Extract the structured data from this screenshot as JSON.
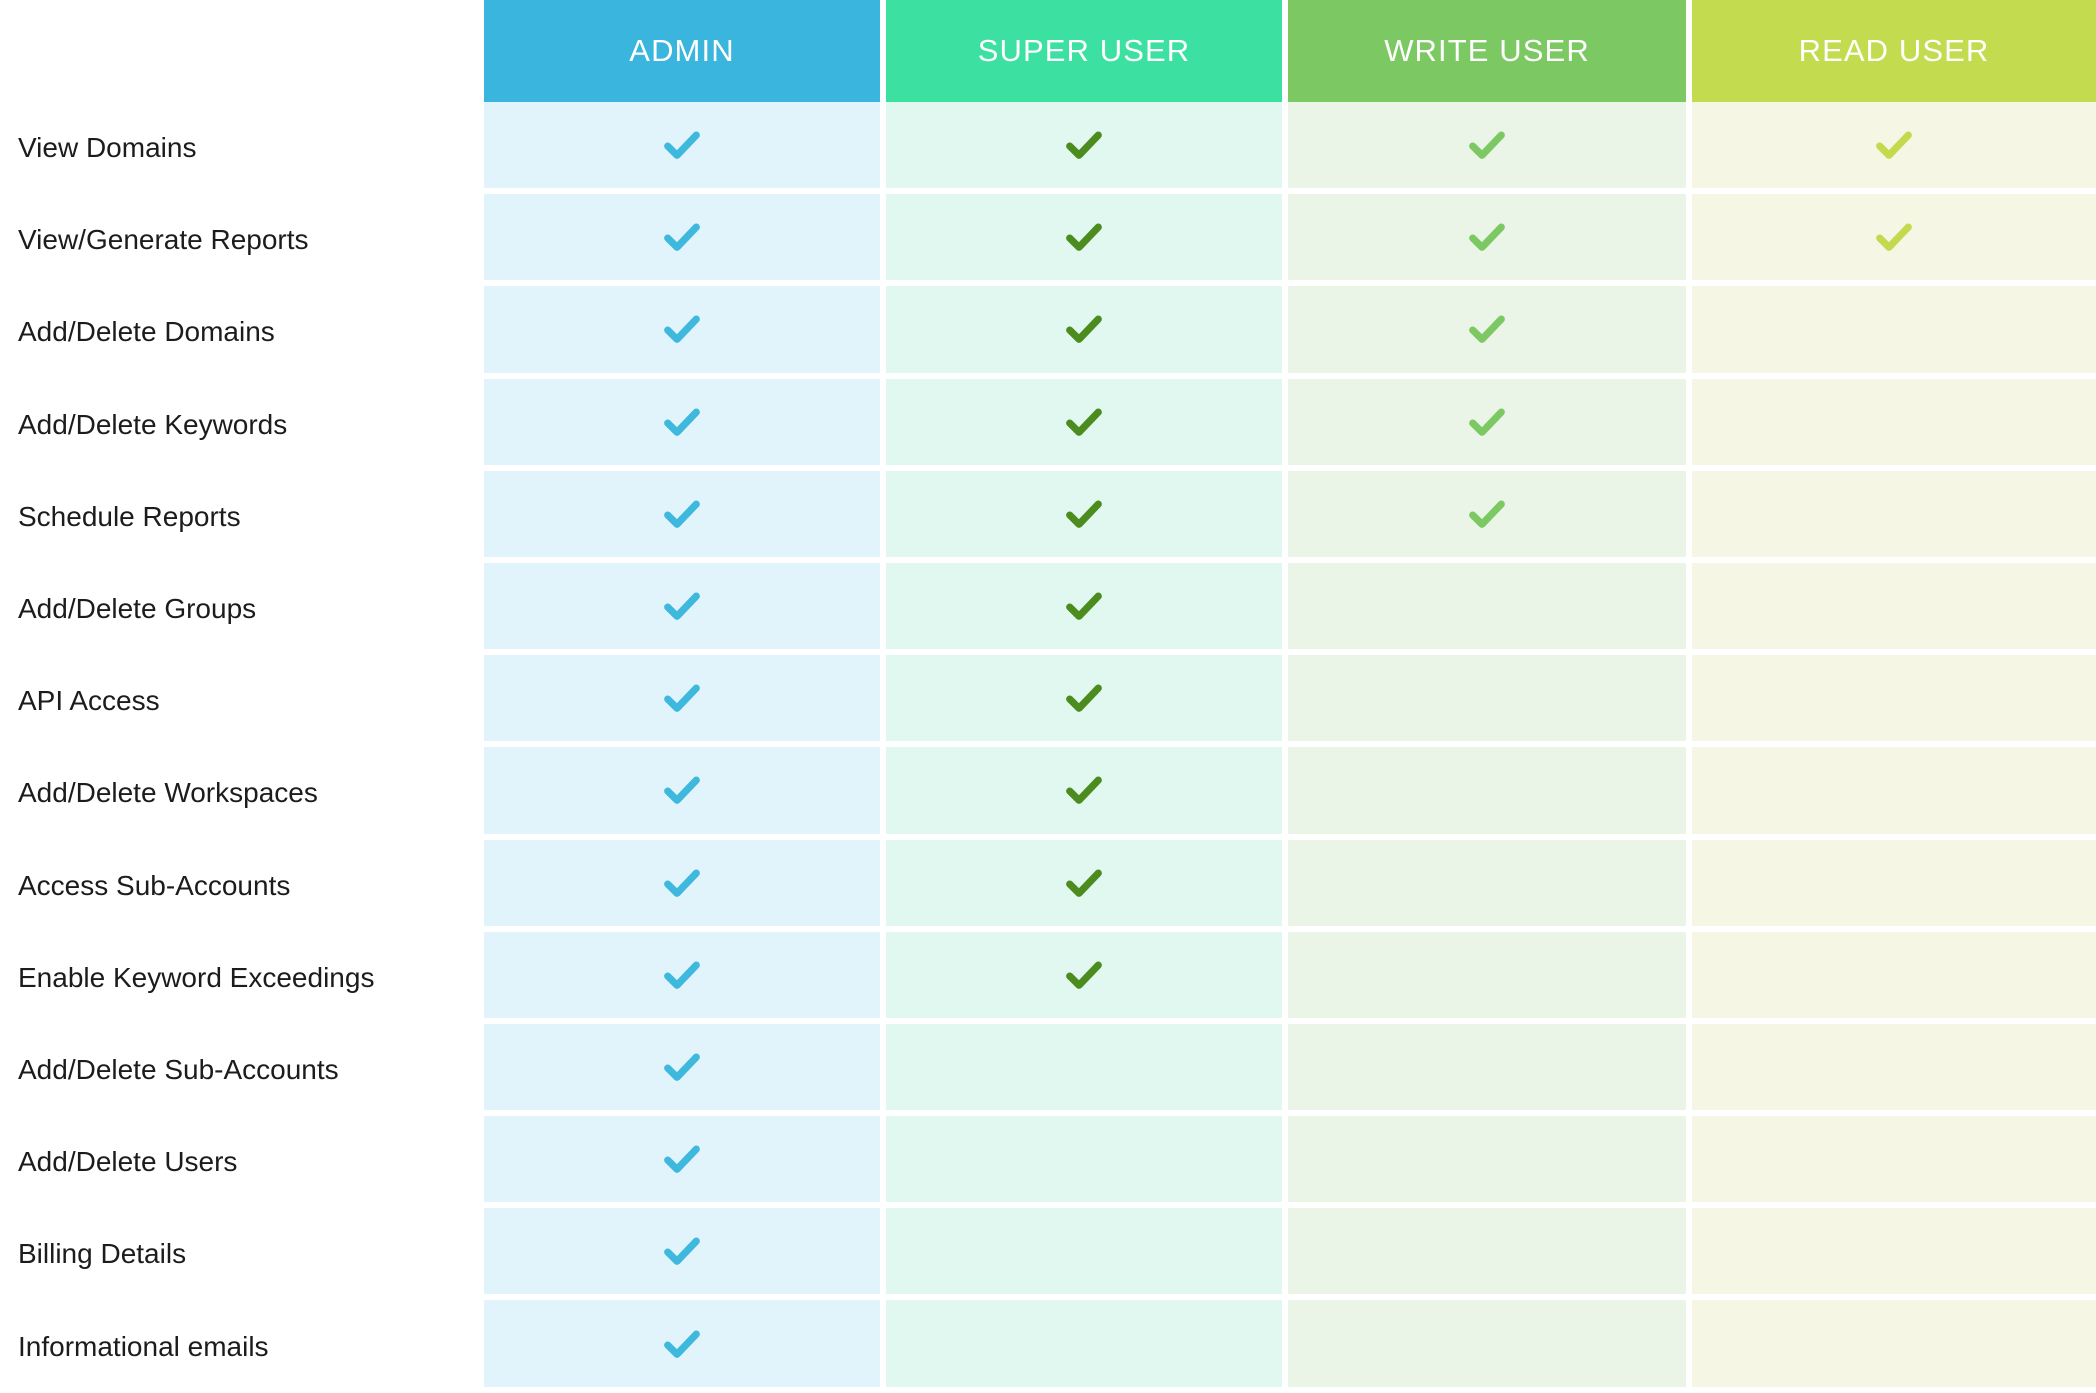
{
  "table": {
    "type": "permission-matrix",
    "columns": [
      {
        "id": "admin",
        "label": "ADMIN",
        "header_color": "#3ab6de",
        "cell_color": "#e2f4fb",
        "check_color": "#3fb8de"
      },
      {
        "id": "super_user",
        "label": "SUPER USER",
        "header_color": "#3ce0a0",
        "cell_color": "#e1f8f0",
        "check_color": "#4c8c1e"
      },
      {
        "id": "write_user",
        "label": "WRITE USER",
        "header_color": "#7cc863",
        "cell_color": "#eaf5e8",
        "check_color": "#7cc863"
      },
      {
        "id": "read_user",
        "label": "READ USER",
        "header_color": "#c3db4e",
        "cell_color": "#f5f7e4",
        "check_color": "#c3d94e"
      }
    ],
    "rows": [
      {
        "label": "View Domains",
        "values": [
          true,
          true,
          true,
          true
        ]
      },
      {
        "label": "View/Generate Reports",
        "values": [
          true,
          true,
          true,
          true
        ]
      },
      {
        "label": "Add/Delete Domains",
        "values": [
          true,
          true,
          true,
          false
        ]
      },
      {
        "label": "Add/Delete Keywords",
        "values": [
          true,
          true,
          true,
          false
        ]
      },
      {
        "label": "Schedule Reports",
        "values": [
          true,
          true,
          true,
          false
        ]
      },
      {
        "label": "Add/Delete Groups",
        "values": [
          true,
          true,
          false,
          false
        ]
      },
      {
        "label": "API Access",
        "values": [
          true,
          true,
          false,
          false
        ]
      },
      {
        "label": "Add/Delete Workspaces",
        "values": [
          true,
          true,
          false,
          false
        ]
      },
      {
        "label": "Access Sub-Accounts",
        "values": [
          true,
          true,
          false,
          false
        ]
      },
      {
        "label": "Enable Keyword Exceedings",
        "values": [
          true,
          true,
          false,
          false
        ]
      },
      {
        "label": "Add/Delete Sub-Accounts",
        "values": [
          true,
          false,
          false,
          false
        ]
      },
      {
        "label": "Add/Delete Users",
        "values": [
          true,
          false,
          false,
          false
        ]
      },
      {
        "label": "Billing Details",
        "values": [
          true,
          false,
          false,
          false
        ]
      },
      {
        "label": "Informational emails",
        "values": [
          true,
          false,
          false,
          false
        ]
      }
    ],
    "icons": {
      "granted": "check-icon"
    }
  }
}
